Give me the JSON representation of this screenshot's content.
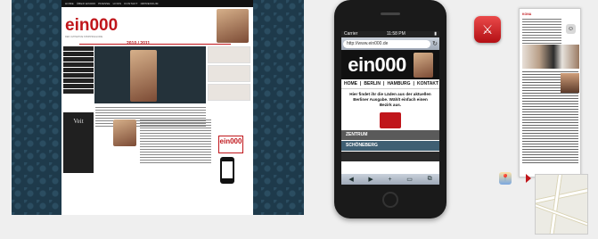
{
  "desktop": {
    "nav_items": [
      "HOME",
      "ÜBER EIN000",
      "PRESSE",
      "LINKS",
      "KONTAKT",
      "IMPRESSUM"
    ],
    "logo": "ein000",
    "tagline": "DER ULTIMATIVE SHOPPINGGUIDE",
    "year": "2010 / 2011",
    "sidebar_brand": "Veit",
    "promo": "ein000"
  },
  "phone": {
    "time": "11:58 PM",
    "carrier": "Carrier",
    "url": "http://www.ein000.de",
    "logo": "ein000",
    "nav": [
      "HOME",
      "BERLIN",
      "HAMBURG",
      "KONTAKT"
    ],
    "intro": "Hier findet ihr die Läden aus der aktuellen Berliner Ausgabe. Wählt einfach einen Bezirk aus.",
    "districts": [
      {
        "name": "ZENTRUM",
        "color": "#5a5a5a"
      },
      {
        "name": "SCHÖNEBERG",
        "color": "#3f5f73"
      },
      {
        "name": "",
        "color": "#2a2a2a"
      }
    ],
    "toolbar_icons": [
      "◀",
      "▶",
      "+",
      "▭",
      "⧉"
    ]
  },
  "detail": {
    "title": "KONA",
    "address": "ALTE SCHÖNHAUSER STR. 27, 10119 BERLIN",
    "app_icon_label": "ein000 app icon"
  }
}
